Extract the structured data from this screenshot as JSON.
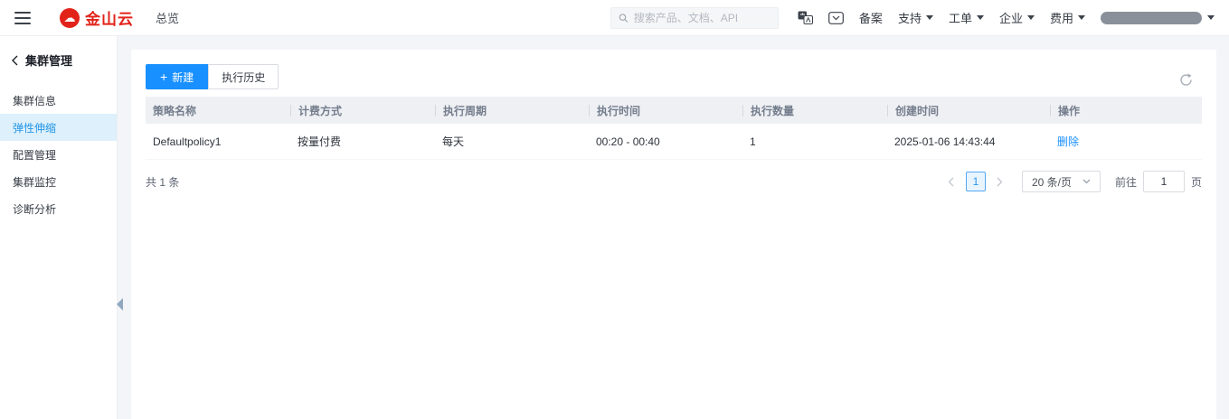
{
  "colors": {
    "accent_blue": "#1890ff",
    "brand_red": "#e2231a",
    "active_item_bg": "#ddf0fb",
    "table_header_bg": "#eef0f4"
  },
  "icons": {
    "plus": "+",
    "cloud": "☁"
  },
  "topbar": {
    "brand": "金山云",
    "overview_label": "总览",
    "search_placeholder": "搜索产品、文档、API",
    "menu": [
      {
        "label": "备案"
      },
      {
        "label": "支持"
      },
      {
        "label": "工单"
      },
      {
        "label": "企业"
      },
      {
        "label": "费用"
      }
    ]
  },
  "sidebar": {
    "title": "集群管理",
    "items": [
      {
        "label": "集群信息"
      },
      {
        "label": "弹性伸缩"
      },
      {
        "label": "配置管理"
      },
      {
        "label": "集群监控"
      },
      {
        "label": "诊断分析"
      }
    ]
  },
  "toolbar": {
    "create_label": "新建",
    "history_label": "执行历史"
  },
  "table": {
    "headers": [
      "策略名称",
      "计费方式",
      "执行周期",
      "执行时间",
      "执行数量",
      "创建时间",
      "操作"
    ],
    "rows": [
      {
        "policy_name": "Defaultpolicy1",
        "billing": "按量付费",
        "cycle": "每天",
        "time": "00:20 - 00:40",
        "count": "1",
        "created": "2025-01-06 14:43:44",
        "action": "删除"
      }
    ]
  },
  "pagination": {
    "total": "共 1 条",
    "current_page": "1",
    "page_size": "20 条/页",
    "goto_label": "前往",
    "goto_value": "1",
    "page_unit": "页"
  }
}
